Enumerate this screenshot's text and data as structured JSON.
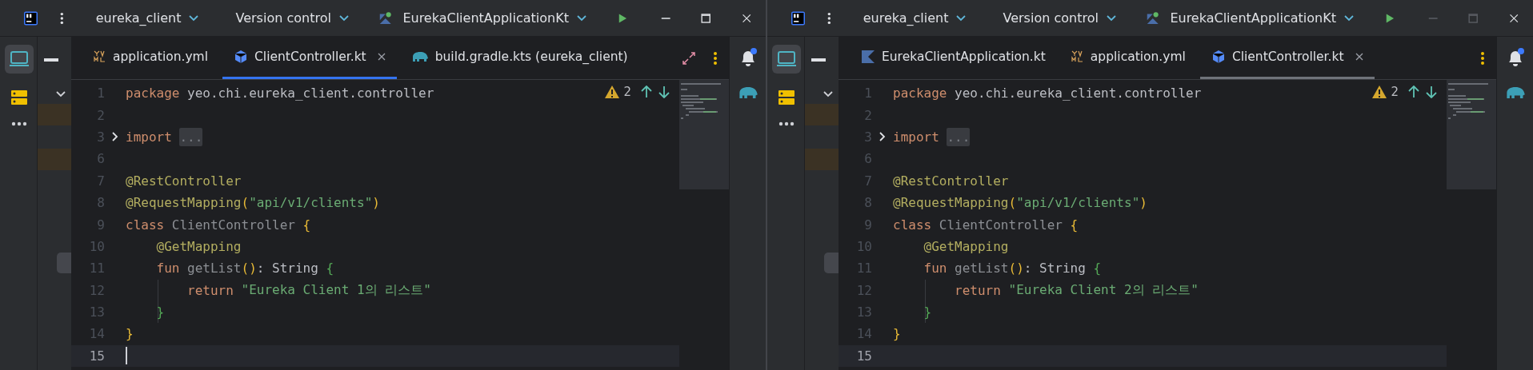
{
  "windows": [
    {
      "focused": true,
      "title_bar": {
        "project": "eureka_client",
        "vcs": "Version control",
        "run_config": "EurekaClientApplicationKt"
      },
      "tabs": [
        {
          "label": "application.yml",
          "kind": "yaml",
          "selected": false
        },
        {
          "label": "ClientController.kt",
          "kind": "class",
          "selected": true
        },
        {
          "label": "build.gradle.kts (eureka_client)",
          "kind": "gradle",
          "selected": false
        }
      ],
      "expand_button": true,
      "editor": {
        "problems": "2",
        "lines": [
          {
            "number": "1",
            "current": false,
            "folded": false,
            "tokens": [
              {
                "kind": "keyword",
                "text": "package "
              },
              {
                "kind": "plain",
                "text": "yeo.chi.eureka_client.controller"
              }
            ]
          },
          {
            "number": "2",
            "current": false,
            "folded": false
          },
          {
            "number": "3",
            "current": false,
            "folded": true,
            "tokens": [
              {
                "kind": "keyword",
                "text": "import "
              },
              {
                "kind": "fold",
                "text": "..."
              }
            ]
          },
          {
            "number": "6",
            "current": false,
            "folded": false
          },
          {
            "number": "7",
            "current": false,
            "folded": false,
            "tokens": [
              {
                "kind": "annotation",
                "text": "@RestController"
              }
            ]
          },
          {
            "number": "8",
            "current": false,
            "folded": false,
            "tokens": [
              {
                "kind": "annotation",
                "text": "@RequestMapping"
              },
              {
                "kind": "brace",
                "text": "("
              },
              {
                "kind": "string",
                "text": "\"api/v1/clients\""
              },
              {
                "kind": "brace",
                "text": ")"
              }
            ]
          },
          {
            "number": "9",
            "current": false,
            "folded": false,
            "tokens": [
              {
                "kind": "keyword",
                "text": "class "
              },
              {
                "kind": "unused",
                "text": "ClientController "
              },
              {
                "kind": "brace",
                "text": "{"
              }
            ]
          },
          {
            "number": "10",
            "current": false,
            "folded": false,
            "tokens": [
              {
                "kind": "annotation",
                "text": "    @GetMapping"
              }
            ]
          },
          {
            "number": "11",
            "current": false,
            "folded": false,
            "tokens": [
              {
                "kind": "keyword",
                "text": "    fun "
              },
              {
                "kind": "unused",
                "text": "getList"
              },
              {
                "kind": "brace",
                "text": "()"
              },
              {
                "kind": "plain",
                "text": ": String "
              },
              {
                "kind": "brace2",
                "text": "{"
              }
            ]
          },
          {
            "number": "12",
            "current": false,
            "folded": false,
            "tokens": [
              {
                "kind": "keyword",
                "text": "        return "
              },
              {
                "kind": "string",
                "text": "\"Eureka Client 1의 리스트\""
              }
            ]
          },
          {
            "number": "13",
            "current": false,
            "folded": false,
            "tokens": [
              {
                "kind": "brace2",
                "text": "    }"
              }
            ]
          },
          {
            "number": "14",
            "current": false,
            "folded": false,
            "tokens": [
              {
                "kind": "brace",
                "text": "}"
              }
            ]
          },
          {
            "number": "15",
            "current": true,
            "folded": false
          }
        ]
      }
    },
    {
      "focused": false,
      "title_bar": {
        "project": "eureka_client",
        "vcs": "Version control",
        "run_config": "EurekaClientApplicationKt"
      },
      "tabs": [
        {
          "label": "EurekaClientApplication.kt",
          "kind": "kotlin",
          "selected": false
        },
        {
          "label": "application.yml",
          "kind": "yaml",
          "selected": false
        },
        {
          "label": "ClientController.kt",
          "kind": "class",
          "selected": true
        }
      ],
      "expand_button": false,
      "editor": {
        "problems": "2",
        "lines": [
          {
            "number": "1",
            "current": false,
            "folded": false,
            "tokens": [
              {
                "kind": "keyword",
                "text": "package "
              },
              {
                "kind": "plain",
                "text": "yeo.chi.eureka_client.controller"
              }
            ]
          },
          {
            "number": "2",
            "current": false,
            "folded": false
          },
          {
            "number": "3",
            "current": false,
            "folded": true,
            "tokens": [
              {
                "kind": "keyword",
                "text": "import "
              },
              {
                "kind": "fold",
                "text": "..."
              }
            ]
          },
          {
            "number": "6",
            "current": false,
            "folded": false
          },
          {
            "number": "7",
            "current": false,
            "folded": false,
            "tokens": [
              {
                "kind": "annotation",
                "text": "@RestController"
              }
            ]
          },
          {
            "number": "8",
            "current": false,
            "folded": false,
            "tokens": [
              {
                "kind": "annotation",
                "text": "@RequestMapping"
              },
              {
                "kind": "brace",
                "text": "("
              },
              {
                "kind": "string",
                "text": "\"api/v1/clients\""
              },
              {
                "kind": "brace",
                "text": ")"
              }
            ]
          },
          {
            "number": "9",
            "current": false,
            "folded": false,
            "tokens": [
              {
                "kind": "keyword",
                "text": "class "
              },
              {
                "kind": "unused",
                "text": "ClientController "
              },
              {
                "kind": "brace",
                "text": "{"
              }
            ]
          },
          {
            "number": "10",
            "current": false,
            "folded": false,
            "tokens": [
              {
                "kind": "annotation",
                "text": "    @GetMapping"
              }
            ]
          },
          {
            "number": "11",
            "current": false,
            "folded": false,
            "tokens": [
              {
                "kind": "keyword",
                "text": "    fun "
              },
              {
                "kind": "unused",
                "text": "getList"
              },
              {
                "kind": "brace",
                "text": "()"
              },
              {
                "kind": "plain",
                "text": ": String "
              },
              {
                "kind": "brace2",
                "text": "{"
              }
            ]
          },
          {
            "number": "12",
            "current": false,
            "folded": false,
            "tokens": [
              {
                "kind": "keyword",
                "text": "        return "
              },
              {
                "kind": "string",
                "text": "\"Eureka Client 2의 리스트\""
              }
            ]
          },
          {
            "number": "13",
            "current": false,
            "folded": false,
            "tokens": [
              {
                "kind": "brace2",
                "text": "    }"
              }
            ]
          },
          {
            "number": "14",
            "current": false,
            "folded": false,
            "tokens": [
              {
                "kind": "brace",
                "text": "}"
              }
            ]
          },
          {
            "number": "15",
            "current": true,
            "folded": false
          }
        ]
      }
    }
  ]
}
